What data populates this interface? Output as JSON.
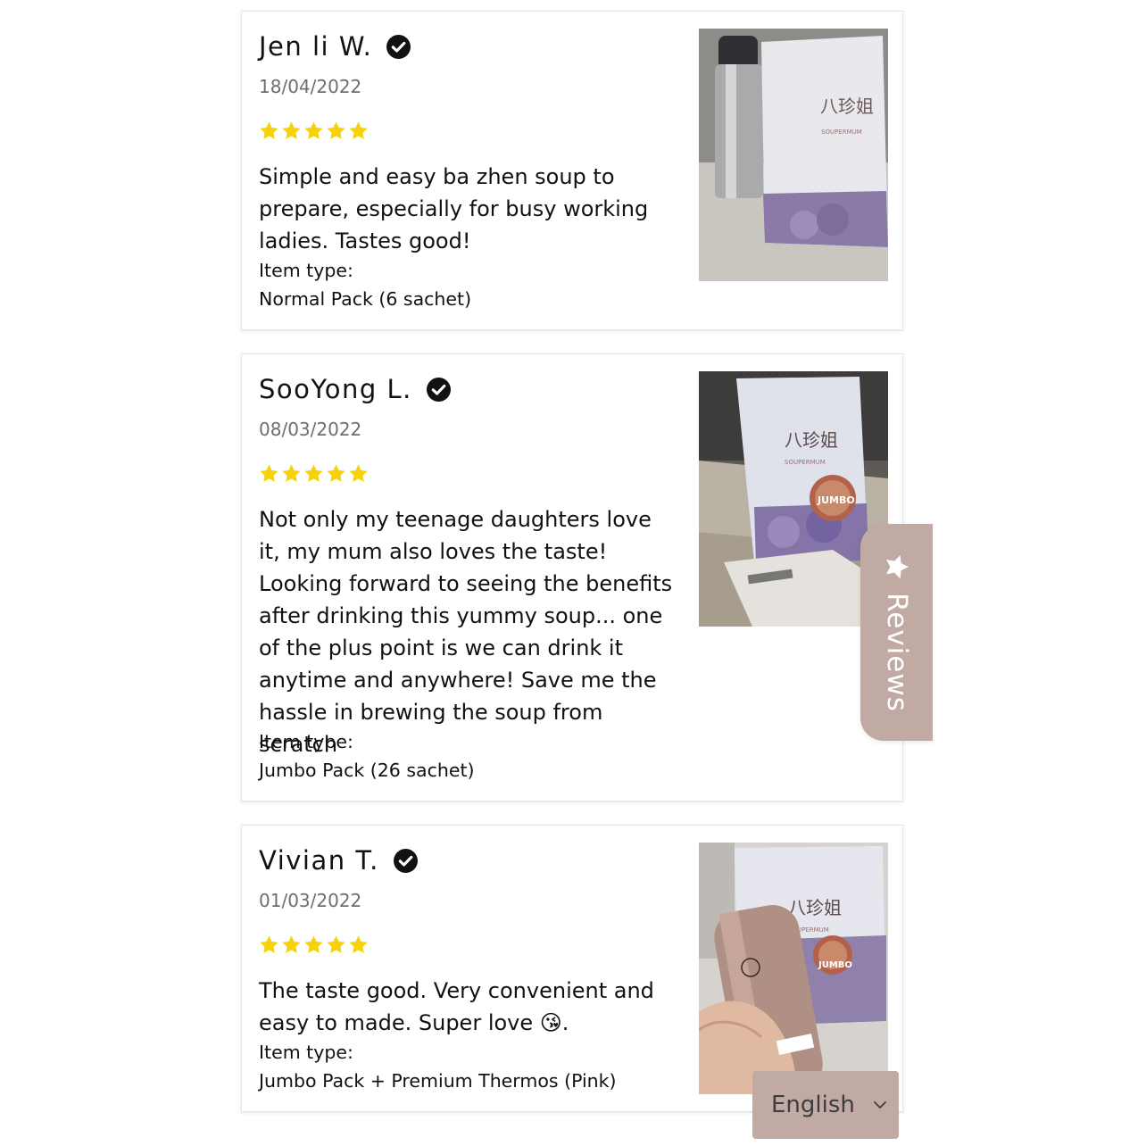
{
  "reviews": [
    {
      "name": "Jen li W.",
      "date": "18/04/2022",
      "rating": 5,
      "text": "Simple and easy ba zhen soup to prepare, especially for busy working ladies. Tastes good!",
      "item_label": "Item type:",
      "item_value": "Normal Pack (6 sachet)",
      "photo_brand": "八珍姐",
      "photo_sub": "SOUPERMUM"
    },
    {
      "name": "SooYong L.",
      "date": "08/03/2022",
      "rating": 5,
      "text": "Not only my teenage daughters love it, my mum also loves the taste! Looking forward to seeing the benefits after drinking this yummy soup... one of the plus point is we can drink it anytime and anywhere! Save me the hassle in brewing the soup from scratch",
      "item_label": "Item type:",
      "item_value": "Jumbo Pack (26 sachet)",
      "photo_brand": "八珍姐",
      "photo_sub": "SOUPERMUM",
      "photo_badge": "JUMBO"
    },
    {
      "name": "Vivian T.",
      "date": "01/03/2022",
      "rating": 5,
      "text": "The taste good. Very convenient and easy to made. Super love 😘.",
      "item_label": "Item type:",
      "item_value": "Jumbo Pack + Premium Thermos (Pink)",
      "photo_brand": "八珍姐",
      "photo_sub": "SOUPERMUM",
      "photo_badge": "JUMBO"
    }
  ],
  "reviews_tab": {
    "label": "Reviews",
    "icon": "star-icon"
  },
  "language": {
    "selected": "English",
    "icon": "chevron-down-icon"
  },
  "colors": {
    "star": "#f5d20a",
    "accent": "#c1aaa3",
    "text": "#111111",
    "muted": "#6e6e6e"
  }
}
